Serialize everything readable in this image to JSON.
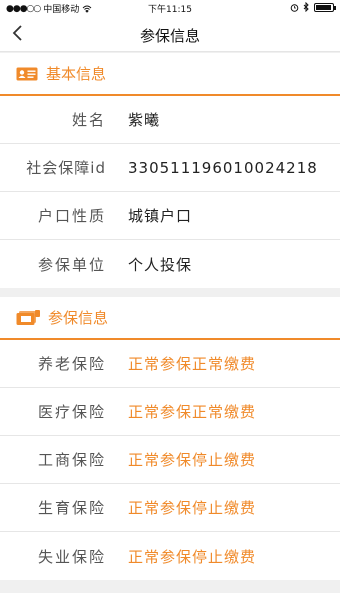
{
  "status": {
    "carrier": "中国移动",
    "time": "下午11:15",
    "signal_icon": "signal-dots-icon",
    "wifi_icon": "wifi-icon",
    "alarm_icon": "alarm-icon",
    "bluetooth_icon": "bluetooth-icon",
    "battery_icon": "battery-icon"
  },
  "nav": {
    "back_icon": "chevron-left-icon",
    "title": "参保信息"
  },
  "basic": {
    "title": "基本信息",
    "icon": "id-card-icon",
    "rows": [
      {
        "label": "姓名",
        "value": "紫曦"
      },
      {
        "label": "社会保障id",
        "value": "330511196010024218"
      },
      {
        "label": "户口性质",
        "value": "城镇户口"
      },
      {
        "label": "参保单位",
        "value": "个人投保"
      }
    ]
  },
  "insurance": {
    "title": "参保信息",
    "icon": "insurance-folder-icon",
    "rows": [
      {
        "label": "养老保险",
        "value": "正常参保正常缴费"
      },
      {
        "label": "医疗保险",
        "value": "正常参保正常缴费"
      },
      {
        "label": "工商保险",
        "value": "正常参保停止缴费"
      },
      {
        "label": "生育保险",
        "value": "正常参保停止缴费"
      },
      {
        "label": "失业保险",
        "value": "正常参保停止缴费"
      }
    ]
  },
  "colors": {
    "accent": "#f08a2a",
    "background": "#f0f0f0"
  }
}
